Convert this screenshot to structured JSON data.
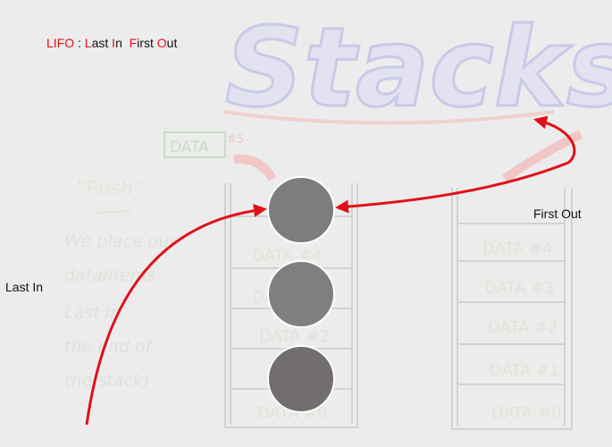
{
  "title": {
    "acronym": "LIFO",
    "separator": " : ",
    "w1_initial": "L",
    "w1_rest": "ast ",
    "w2_initial": "I",
    "w2_rest": "n  ",
    "w3_initial": "F",
    "w3_rest": "irst ",
    "w4_initial": "O",
    "w4_rest": "ut"
  },
  "labels": {
    "last_in": "Last In",
    "first_out": "First Out"
  },
  "background": {
    "heading": "Stacks",
    "incoming": "DATA",
    "incoming_num": "#5",
    "push_label": "\"Push\"",
    "notes": [
      "We place our",
      "data/items",
      "Last In",
      "the end of",
      "the stack)"
    ],
    "left_stack": [
      "DATA #4",
      "DATA #3",
      "DATA #2",
      "DATA #0"
    ],
    "right_stack": [
      "DATA #4",
      "DATA #3",
      "DATA #2",
      "DATA #1",
      "DATA #0"
    ]
  },
  "circles": [
    {
      "name": "top",
      "color": "#7d7d7d"
    },
    {
      "name": "middle",
      "color": "#7f7f7f"
    },
    {
      "name": "bottom",
      "color": "#736e6e"
    }
  ],
  "colors": {
    "accent": "#e0101a",
    "arrow": "#e0101a",
    "sketch_blue": "#c9c9e8",
    "sketch_red": "#efc9c9",
    "sketch_green": "#c8dcc6"
  }
}
